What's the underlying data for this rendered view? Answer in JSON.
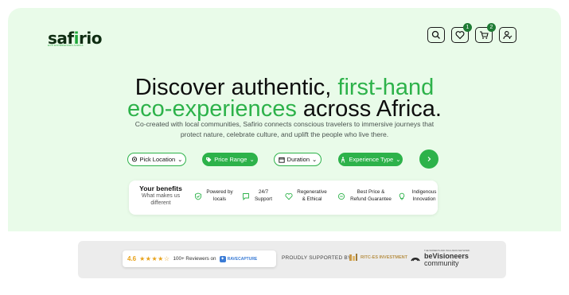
{
  "header": {
    "logo_text_pre": "saf",
    "logo_text_i": "i",
    "logo_text_post": "rio",
    "logo_tagline": "ECO EXPERIENCES AFRICA",
    "wishlist_count": "1",
    "cart_count": "2",
    "icons": [
      "search-icon",
      "heart-icon",
      "cart-icon",
      "user-icon"
    ]
  },
  "hero": {
    "title_part1": "Discover authentic, ",
    "title_highlight1": "first-hand",
    "title_highlight2": "eco-experiences",
    "title_part2": " across Africa.",
    "subtitle": "Co-created with local communities, Safirio connects conscious travelers to immersive journeys that protect nature, celebrate culture, and uplift the people who live there."
  },
  "filters": {
    "location": "Pick Location",
    "price": "Price Range",
    "duration": "Duration",
    "experience": "Experience Type"
  },
  "benefits": {
    "title": "Your benefits",
    "subtitle": "What makes us different",
    "items": [
      {
        "label": "Powered by locals",
        "icon": "shield-check-icon"
      },
      {
        "label": "24/7 Support",
        "icon": "chat-icon"
      },
      {
        "label": "Regenerative & Ethical",
        "icon": "heart-icon"
      },
      {
        "label": "Best Price & Refund Guarantee",
        "icon": "price-tag-icon"
      },
      {
        "label": "Indigenous Innovation",
        "icon": "lightbulb-icon"
      }
    ]
  },
  "trust": {
    "score": "4.6",
    "stars": "★★★★☆",
    "reviewers": "100+ Reviewers on",
    "ravecapture": "RAVECAPTURE",
    "proudly": "PROUDLY SUPPORTED BY",
    "ritc": "RITC-ES INVESTMENT",
    "bev_small": "THE WOMEN'S AND INCLUSION NETWORK",
    "bev_name": "beVisioneers",
    "bev_comm": "community"
  },
  "colors": {
    "accent": "#2db24a",
    "hero_bg": "#e9fbe9",
    "badge": "#1e7b34"
  }
}
